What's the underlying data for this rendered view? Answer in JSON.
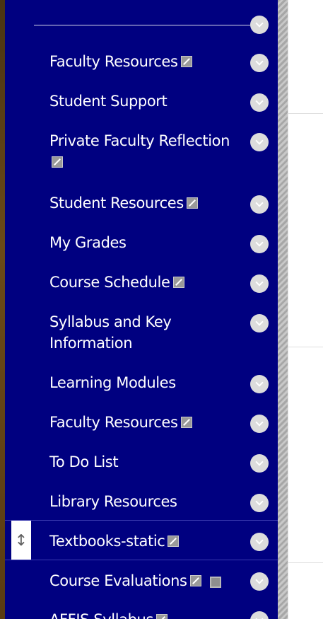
{
  "menu": [
    {
      "label": "Faculty Resources",
      "hidden_icon": true
    },
    {
      "label": "Student Support",
      "hidden_icon": false
    },
    {
      "label": "Private Faculty Reflection",
      "hidden_icon": true
    },
    {
      "label": "Student Resources",
      "hidden_icon": true
    },
    {
      "label": "My Grades",
      "hidden_icon": false
    },
    {
      "label": "Course Schedule",
      "hidden_icon": true
    },
    {
      "label": "Syllabus and Key Information",
      "hidden_icon": false
    },
    {
      "label": "Learning Modules",
      "hidden_icon": false
    },
    {
      "label": "Faculty Resources",
      "hidden_icon": true
    },
    {
      "label": "To Do List",
      "hidden_icon": false
    },
    {
      "label": "Library Resources",
      "hidden_icon": false
    },
    {
      "label": "Textbooks-static",
      "hidden_icon": true,
      "selected": true
    },
    {
      "label": "Course Evaluations",
      "hidden_icon": true,
      "page_icon": true
    },
    {
      "label": "AFFIS Syllabus",
      "hidden_icon": true
    }
  ],
  "icons": {
    "chevron": "chevron-down-icon",
    "hidden": "hidden-from-students-icon",
    "drag": "drag-handle-icon",
    "page": "page-icon"
  },
  "colors": {
    "sidebar_bg": "#000080",
    "text": "#ffffff",
    "chevron_bg": "#dcdcdc",
    "separator": "#3b3bb0"
  }
}
